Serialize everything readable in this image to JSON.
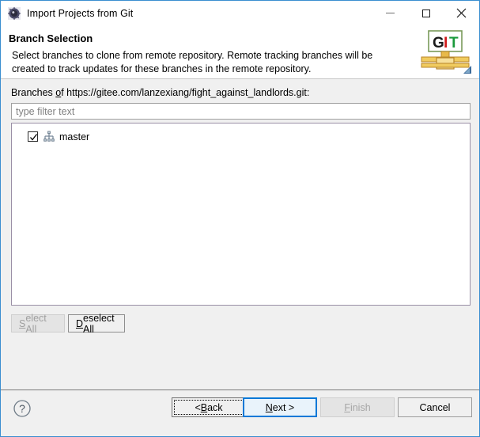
{
  "window": {
    "title": "Import Projects from Git",
    "icon": "eclipse-wizard-icon",
    "controls": {
      "minimize": "minimize-icon",
      "maximize": "maximize-icon",
      "close": "close-icon"
    }
  },
  "header": {
    "title": "Branch Selection",
    "description": "Select branches to clone from remote repository. Remote tracking branches will be created to track updates for these branches in the remote repository.",
    "banner_icon": "git-banner-logo",
    "banner_text": {
      "g": "G",
      "i": "I",
      "t": "T"
    }
  },
  "content": {
    "branches_label_prefix": "Branches ",
    "branches_label_mnemonic": "o",
    "branches_label_suffix": "f https://gitee.com/lanzexiang/fight_against_landlords.git:",
    "repository_url": "https://gitee.com/lanzexiang/fight_against_landlords.git",
    "filter": {
      "value": "",
      "placeholder": "type filter text"
    },
    "branches": [
      {
        "name": "master",
        "checked": true,
        "icon": "git-branch-icon"
      }
    ],
    "select_all": {
      "prefix": "",
      "mnemonic": "S",
      "suffix": "elect All",
      "enabled": false
    },
    "deselect_all": {
      "prefix": "",
      "mnemonic": "D",
      "suffix": "eselect All",
      "enabled": true
    }
  },
  "footer": {
    "help": "help-icon",
    "back": {
      "prefix": "< ",
      "mnemonic": "B",
      "suffix": "ack",
      "enabled": true
    },
    "next": {
      "prefix": "",
      "mnemonic": "N",
      "suffix": "ext >",
      "enabled": true,
      "default": true
    },
    "finish": {
      "prefix": "",
      "mnemonic": "F",
      "suffix": "inish",
      "enabled": false
    },
    "cancel": {
      "prefix": "",
      "mnemonic": "",
      "suffix": "Cancel",
      "enabled": true
    }
  },
  "colors": {
    "accent": "#0078d7",
    "window_border": "#3a8ed0",
    "dialog_bg": "#f0f0f0",
    "field_bg": "#ffffff",
    "disabled_text": "#a0a0a0"
  }
}
